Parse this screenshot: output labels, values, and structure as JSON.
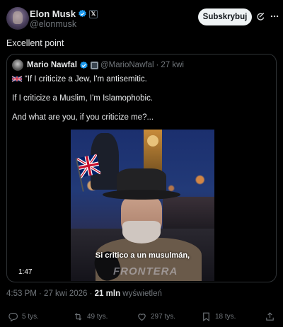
{
  "author": {
    "name": "Elon Musk",
    "handle": "@elonmusk",
    "verified_color": "#1d9bf0"
  },
  "header": {
    "subscribe_label": "Subskrybuj"
  },
  "tweet": {
    "text": "Excellent point",
    "timestamp": "4:53 PM · 27 kwi 2026 · ",
    "views_count": "21 mln",
    "views_label": " wyświetleń"
  },
  "quote": {
    "name": "Mario Nawfal",
    "handle": "@MarioNawfal",
    "separator": "·",
    "date": "27 kwi",
    "line1": "“If I criticize a Jew, I'm antisemitic.",
    "line2": "If I criticize a Muslim, I'm Islamophobic.",
    "line3": "And what are you, if you criticize me?...",
    "video": {
      "caption": "Si critico a un musulmán,",
      "watermark": "FRONTERA",
      "duration": "1:47"
    }
  },
  "actions": {
    "replies": "5 tys.",
    "reposts": "49 tys.",
    "likes": "297 tys.",
    "bookmarks": "18 tys."
  },
  "icons": [
    "verified-icon",
    "x-affiliate-icon",
    "grok-icon",
    "more-icon",
    "uk-flag-icon",
    "reply-icon",
    "repost-icon",
    "like-icon",
    "bookmark-icon",
    "share-icon"
  ]
}
